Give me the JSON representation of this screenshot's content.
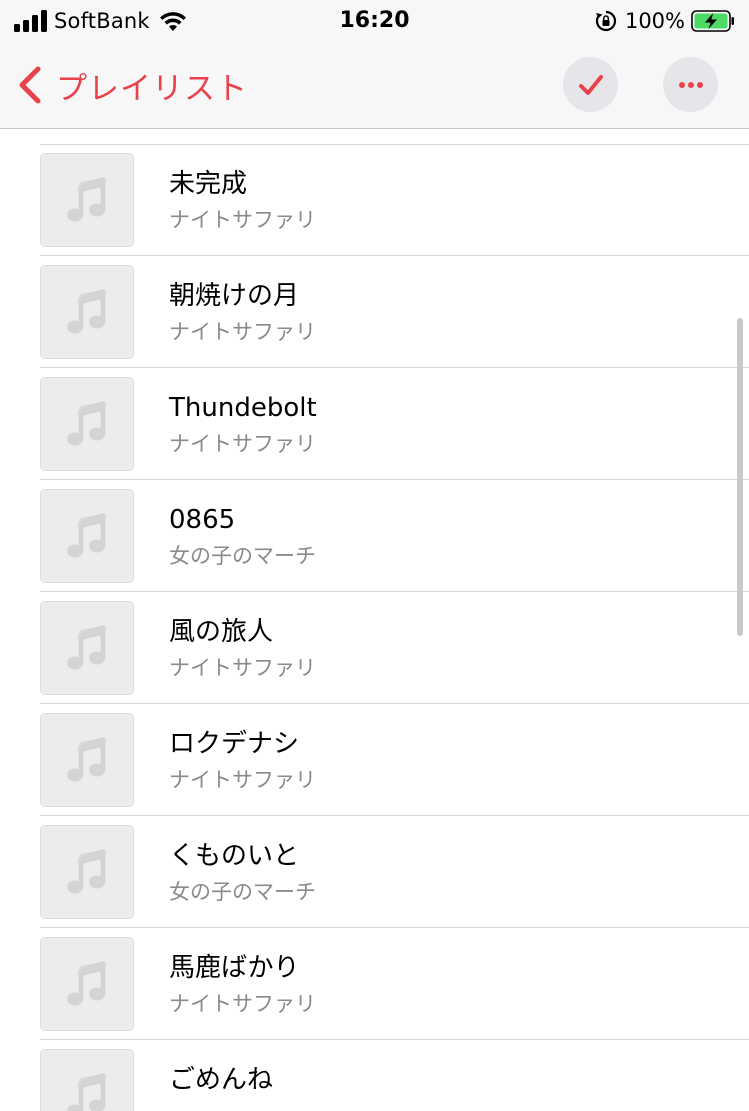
{
  "status_bar": {
    "carrier": "SoftBank",
    "time": "16:20",
    "battery": "100%",
    "icons": [
      "signal-icon",
      "wifi-icon",
      "lock-rotation-icon",
      "battery-charging-icon"
    ]
  },
  "nav": {
    "back_label": "プレイリスト",
    "icons": [
      "back-chevron-icon",
      "check-icon",
      "more-icon"
    ]
  },
  "colors": {
    "accent": "#e8424d",
    "battery_green": "#4cd964",
    "secondary_text": "#8a8a8e",
    "artwork_bg": "#ececec"
  },
  "songs": [
    {
      "title": "未完成",
      "artist": "ナイトサファリ"
    },
    {
      "title": "朝焼けの月",
      "artist": "ナイトサファリ"
    },
    {
      "title": "Thundebolt",
      "artist": "ナイトサファリ"
    },
    {
      "title": "0865",
      "artist": "女の子のマーチ"
    },
    {
      "title": "風の旅人",
      "artist": "ナイトサファリ"
    },
    {
      "title": "ロクデナシ",
      "artist": "ナイトサファリ"
    },
    {
      "title": "くものいと",
      "artist": "女の子のマーチ"
    },
    {
      "title": "馬鹿ばかり",
      "artist": "ナイトサファリ"
    },
    {
      "title": "ごめんね",
      "artist": ""
    }
  ]
}
